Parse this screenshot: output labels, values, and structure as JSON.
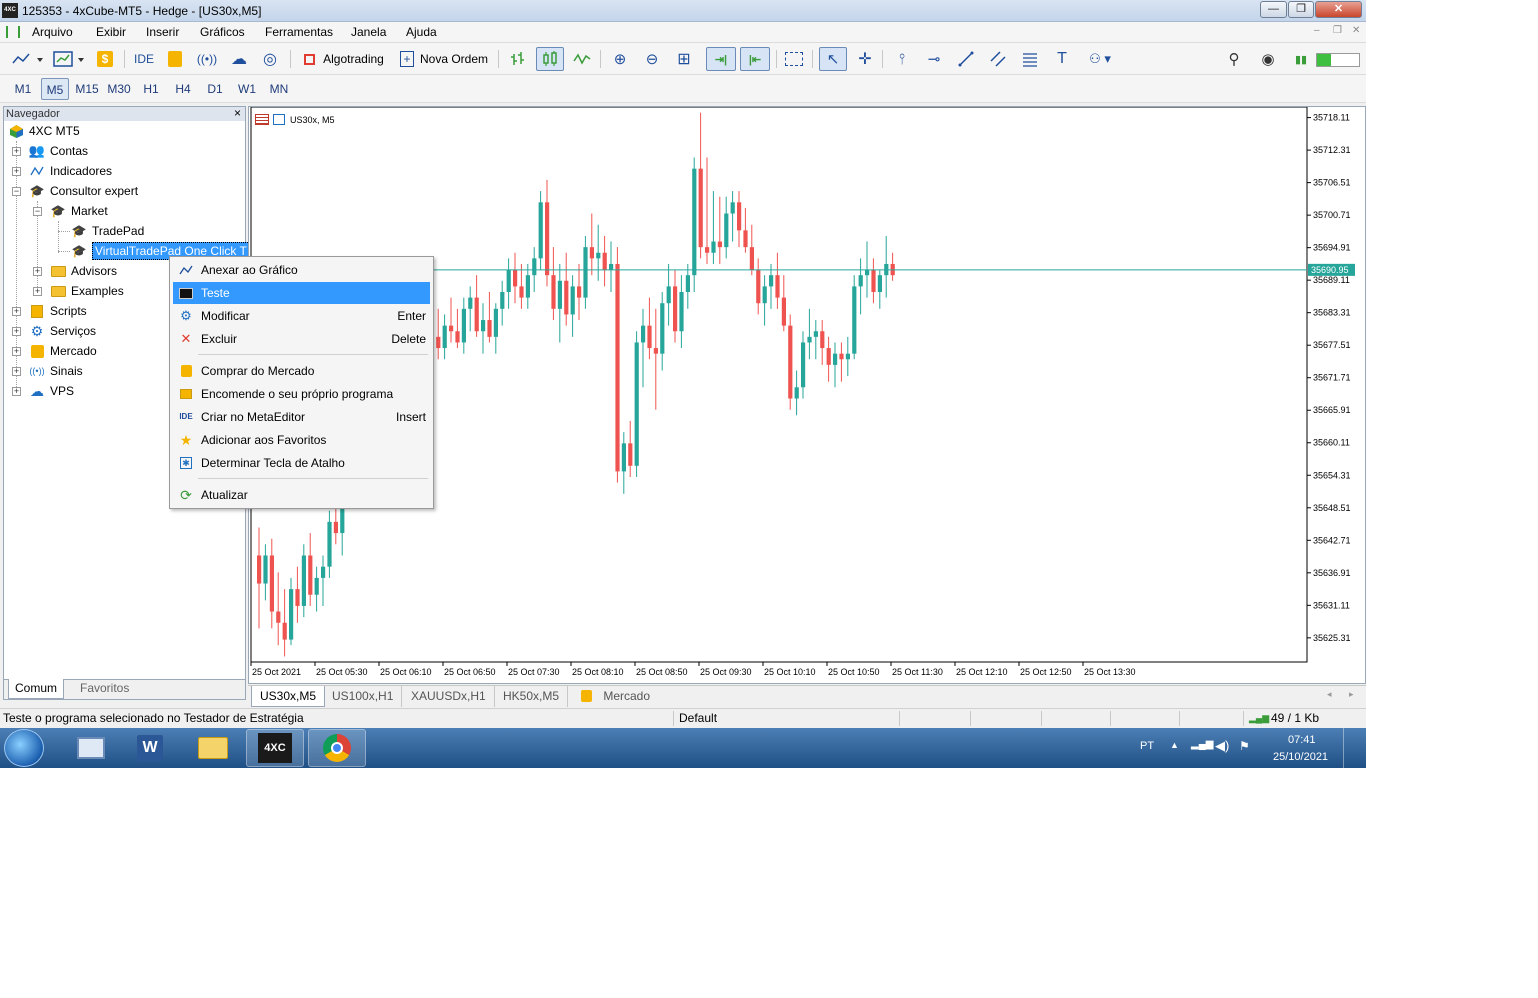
{
  "window": {
    "title": "125353 - 4xCube-MT5 - Hedge - [US30x,M5]",
    "logo_text": "4XC",
    "buttons": {
      "minimize": "—",
      "restore": "❐",
      "close": "✕"
    }
  },
  "menu": {
    "items": [
      "Arquivo",
      "Exibir",
      "Inserir",
      "Gráficos",
      "Ferramentas",
      "Janela",
      "Ajuda"
    ],
    "mdi_buttons": [
      "–",
      "❐",
      "✕"
    ]
  },
  "toolbar": {
    "ide_label": "IDE",
    "algotrading_label": "Algotrading",
    "new_order_label": "Nova Ordem",
    "colors": {
      "accent": "#1f4e9c",
      "algotrading_square": "#e03c31",
      "signal_bar": "#3fbf3f"
    }
  },
  "timeframes": {
    "items": [
      "M1",
      "M5",
      "M15",
      "M30",
      "H1",
      "H4",
      "D1",
      "W1",
      "MN"
    ],
    "active": "M5"
  },
  "navigator": {
    "header": "Navegador",
    "close": "×",
    "tree": {
      "root": "4XC MT5",
      "contas": "Contas",
      "indicadores": "Indicadores",
      "consultor": "Consultor expert",
      "market": "Market",
      "tradepad": "TradePad",
      "virtualtradepad": "VirtualTradePad One Click T",
      "advisors": "Advisors",
      "examples": "Examples",
      "scripts": "Scripts",
      "servicos": "Serviços",
      "mercado": "Mercado",
      "sinais": "Sinais",
      "vps": "VPS"
    },
    "tabs": [
      "Comum",
      "Favoritos"
    ]
  },
  "chart": {
    "label": "US30x, M5",
    "current_price": "35690.95",
    "colors": {
      "bull": "#26a69a",
      "bear": "#ef5350",
      "price_line": "#26a69a",
      "grid": "#ffffff"
    }
  },
  "chart_data": {
    "type": "candlestick",
    "symbol": "US30x",
    "timeframe": "M5",
    "y_ticks": [
      "35718.11",
      "35712.31",
      "35706.51",
      "35700.71",
      "35694.91",
      "35689.11",
      "35683.31",
      "35677.51",
      "35671.71",
      "35665.91",
      "35660.11",
      "35654.31",
      "35648.51",
      "35642.71",
      "35636.91",
      "35631.11",
      "35625.31"
    ],
    "x_ticks": [
      "25 Oct 2021",
      "25 Oct 05:30",
      "25 Oct 06:10",
      "25 Oct 06:50",
      "25 Oct 07:30",
      "25 Oct 08:10",
      "25 Oct 08:50",
      "25 Oct 09:30",
      "25 Oct 10:10",
      "25 Oct 10:50",
      "25 Oct 11:30",
      "25 Oct 12:10",
      "25 Oct 12:50",
      "25 Oct 13:30"
    ],
    "ylim": [
      35621.0,
      35720.0
    ],
    "price_line": 35690.95,
    "candles": [
      [
        35640.0,
        35645.0,
        35627.0,
        35635.0
      ],
      [
        35635.0,
        35642.0,
        35632.0,
        35640.0
      ],
      [
        35640.0,
        35643.0,
        35627.0,
        35630.0
      ],
      [
        35630.0,
        35637.0,
        35624.0,
        35628.0
      ],
      [
        35628.0,
        35634.0,
        35622.0,
        35625.0
      ],
      [
        35625.0,
        35636.0,
        35624.0,
        35634.0
      ],
      [
        35634.0,
        35638.0,
        35628.0,
        35631.0
      ],
      [
        35631.0,
        35642.0,
        35629.0,
        35640.0
      ],
      [
        35640.0,
        35644.0,
        35631.0,
        35633.0
      ],
      [
        35633.0,
        35638.0,
        35630.0,
        35636.0
      ],
      [
        35636.0,
        35640.0,
        35631.0,
        35638.0
      ],
      [
        35638.0,
        35648.0,
        35636.0,
        35646.0
      ],
      [
        35646.0,
        35652.0,
        35642.0,
        35644.0
      ],
      [
        35644.0,
        35686.0,
        35640.0,
        35684.0
      ],
      [
        35684.0,
        35688.0,
        35675.0,
        35678.0
      ],
      [
        35678.0,
        35684.0,
        35676.0,
        35682.0
      ],
      [
        35682.0,
        35692.0,
        35680.0,
        35690.0
      ],
      [
        35690.0,
        35693.0,
        35684.0,
        35686.0
      ],
      [
        35686.0,
        35690.0,
        35679.0,
        35681.0
      ],
      [
        35681.0,
        35686.0,
        35678.0,
        35683.0
      ],
      [
        35683.0,
        35688.0,
        35680.0,
        35682.0
      ],
      [
        35682.0,
        35686.0,
        35679.0,
        35680.0
      ],
      [
        35680.0,
        35685.0,
        35677.0,
        35678.0
      ],
      [
        35678.0,
        35682.0,
        35674.0,
        35676.0
      ],
      [
        35676.0,
        35682.0,
        35670.0,
        35680.0
      ],
      [
        35680.0,
        35685.0,
        35676.0,
        35678.0
      ],
      [
        35678.0,
        35683.0,
        35674.0,
        35675.0
      ],
      [
        35675.0,
        35681.0,
        35673.0,
        35679.0
      ],
      [
        35679.0,
        35684.0,
        35675.0,
        35677.0
      ],
      [
        35677.0,
        35683.0,
        35675.0,
        35681.0
      ],
      [
        35681.0,
        35686.0,
        35678.0,
        35680.0
      ],
      [
        35680.0,
        35684.0,
        35677.0,
        35678.0
      ],
      [
        35678.0,
        35686.0,
        35676.0,
        35684.0
      ],
      [
        35684.0,
        35688.0,
        35680.0,
        35686.0
      ],
      [
        35686.0,
        35690.0,
        35679.0,
        35680.0
      ],
      [
        35680.0,
        35685.0,
        35676.0,
        35682.0
      ],
      [
        35682.0,
        35687.0,
        35678.0,
        35679.0
      ],
      [
        35679.0,
        35685.0,
        35676.0,
        35684.0
      ],
      [
        35684.0,
        35689.0,
        35681.0,
        35687.0
      ],
      [
        35687.0,
        35693.0,
        35684.0,
        35691.0
      ],
      [
        35691.0,
        35694.0,
        35685.0,
        35688.0
      ],
      [
        35688.0,
        35692.0,
        35684.0,
        35686.0
      ],
      [
        35686.0,
        35692.0,
        35684.0,
        35690.0
      ],
      [
        35690.0,
        35695.0,
        35687.0,
        35693.0
      ],
      [
        35693.0,
        35705.0,
        35691.0,
        35703.0
      ],
      [
        35703.0,
        35707.0,
        35688.0,
        35690.0
      ],
      [
        35690.0,
        35695.0,
        35682.0,
        35684.0
      ],
      [
        35684.0,
        35692.0,
        35678.0,
        35689.0
      ],
      [
        35689.0,
        35694.0,
        35681.0,
        35683.0
      ],
      [
        35683.0,
        35690.0,
        35679.0,
        35688.0
      ],
      [
        35688.0,
        35692.0,
        35682.0,
        35686.0
      ],
      [
        35686.0,
        35697.0,
        35684.0,
        35695.0
      ],
      [
        35695.0,
        35701.0,
        35690.0,
        35693.0
      ],
      [
        35693.0,
        35699.0,
        35689.0,
        35694.0
      ],
      [
        35694.0,
        35697.0,
        35688.0,
        35691.0
      ],
      [
        35691.0,
        35696.0,
        35687.0,
        35692.0
      ],
      [
        35692.0,
        35695.0,
        35653.0,
        35655.0
      ],
      [
        35655.0,
        35662.0,
        35651.0,
        35660.0
      ],
      [
        35660.0,
        35664.0,
        35654.0,
        35656.0
      ],
      [
        35656.0,
        35680.0,
        35654.0,
        35678.0
      ],
      [
        35678.0,
        35684.0,
        35670.0,
        35681.0
      ],
      [
        35681.0,
        35686.0,
        35675.0,
        35677.0
      ],
      [
        35677.0,
        35684.0,
        35666.0,
        35676.0
      ],
      [
        35676.0,
        35687.0,
        35673.0,
        35685.0
      ],
      [
        35685.0,
        35692.0,
        35681.0,
        35688.0
      ],
      [
        35688.0,
        35691.0,
        35678.0,
        35680.0
      ],
      [
        35680.0,
        35690.0,
        35677.0,
        35687.0
      ],
      [
        35687.0,
        35692.0,
        35684.0,
        35690.0
      ],
      [
        35690.0,
        35711.0,
        35687.0,
        35709.0
      ],
      [
        35709.0,
        35719.0,
        35693.0,
        35695.0
      ],
      [
        35695.0,
        35711.0,
        35692.0,
        35694.0
      ],
      [
        35694.0,
        35705.0,
        35692.0,
        35696.0
      ],
      [
        35696.0,
        35704.0,
        35692.0,
        35695.0
      ],
      [
        35695.0,
        35704.0,
        35693.0,
        35701.0
      ],
      [
        35701.0,
        35705.0,
        35696.0,
        35703.0
      ],
      [
        35703.0,
        35705.0,
        35695.0,
        35698.0
      ],
      [
        35698.0,
        35702.0,
        35694.0,
        35695.0
      ],
      [
        35695.0,
        35699.0,
        35690.0,
        35691.0
      ],
      [
        35691.0,
        35693.0,
        35683.0,
        35685.0
      ],
      [
        35685.0,
        35690.0,
        35681.0,
        35688.0
      ],
      [
        35688.0,
        35692.0,
        35684.0,
        35690.0
      ],
      [
        35690.0,
        35694.0,
        35684.0,
        35686.0
      ],
      [
        35686.0,
        35690.0,
        35680.0,
        35681.0
      ],
      [
        35681.0,
        35683.0,
        35666.0,
        35668.0
      ],
      [
        35668.0,
        35673.0,
        35665.0,
        35670.0
      ],
      [
        35670.0,
        35680.0,
        35668.0,
        35678.0
      ],
      [
        35678.0,
        35684.0,
        35675.0,
        35679.0
      ],
      [
        35679.0,
        35682.0,
        35675.0,
        35680.0
      ],
      [
        35680.0,
        35682.0,
        35674.0,
        35677.0
      ],
      [
        35677.0,
        35679.0,
        35671.0,
        35674.0
      ],
      [
        35674.0,
        35678.0,
        35670.0,
        35676.0
      ],
      [
        35676.0,
        35678.0,
        35671.0,
        35675.0
      ],
      [
        35675.0,
        35679.0,
        35672.0,
        35676.0
      ],
      [
        35676.0,
        35690.0,
        35675.0,
        35688.0
      ],
      [
        35688.0,
        35693.0,
        35683.0,
        35690.0
      ],
      [
        35690.0,
        35696.0,
        35686.0,
        35691.0
      ],
      [
        35691.0,
        35693.0,
        35685.0,
        35687.0
      ],
      [
        35687.0,
        35691.0,
        35684.0,
        35690.0
      ],
      [
        35690.0,
        35697.0,
        35686.0,
        35692.0
      ],
      [
        35692.0,
        35694.0,
        35689.0,
        35690.0
      ]
    ]
  },
  "chart_tabs": [
    "US30x,M5",
    "US100x,H1",
    "XAUUSDx,H1",
    "HK50x,M5",
    "Mercado"
  ],
  "context_menu": {
    "items": [
      {
        "label": "Anexar ao Gráfico",
        "shortcut": ""
      },
      {
        "label": "Teste",
        "shortcut": ""
      },
      {
        "label": "Modificar",
        "shortcut": "Enter"
      },
      {
        "label": "Excluir",
        "shortcut": "Delete"
      },
      {
        "label": "Comprar do Mercado",
        "shortcut": ""
      },
      {
        "label": "Encomende o seu próprio programa",
        "shortcut": ""
      },
      {
        "label": "Criar no MetaEditor",
        "shortcut": "Insert"
      },
      {
        "label": "Adicionar aos Favoritos",
        "shortcut": ""
      },
      {
        "label": "Determinar Tecla de Atalho",
        "shortcut": ""
      },
      {
        "label": "Atualizar",
        "shortcut": ""
      }
    ]
  },
  "statusbar": {
    "message": "Teste o programa selecionado no Testador de Estratégia",
    "profile": "Default",
    "traffic": "49 / 1 Kb"
  },
  "taskbar": {
    "lang": "PT",
    "time": "07:41",
    "date": "25/10/2021",
    "apps": [
      "4XC"
    ]
  }
}
